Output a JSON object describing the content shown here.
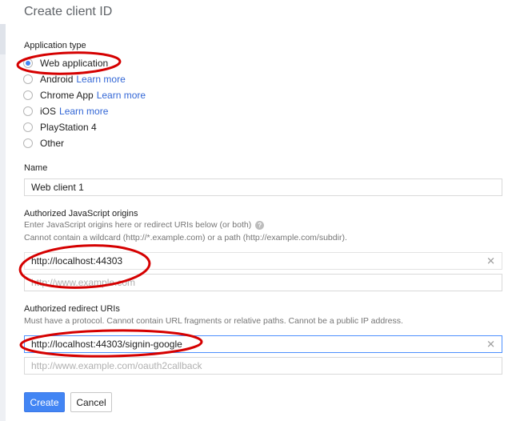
{
  "page": {
    "title": "Create client ID"
  },
  "application_type": {
    "label": "Application type",
    "options": [
      {
        "label": "Web application",
        "link": "",
        "checked": true
      },
      {
        "label": "Android",
        "link": "Learn more",
        "checked": false
      },
      {
        "label": "Chrome App",
        "link": "Learn more",
        "checked": false
      },
      {
        "label": "iOS",
        "link": "Learn more",
        "checked": false
      },
      {
        "label": "PlayStation 4",
        "link": "",
        "checked": false
      },
      {
        "label": "Other",
        "link": "",
        "checked": false
      }
    ]
  },
  "name": {
    "label": "Name",
    "value": "Web client 1"
  },
  "js_origins": {
    "label": "Authorized JavaScript origins",
    "hint1": "Enter JavaScript origins here or redirect URIs below (or both)",
    "hint2": "Cannot contain a wildcard (http://*.example.com) or a path (http://example.com/subdir).",
    "value": "http://localhost:44303",
    "placeholder": "http://www.example.com",
    "clear_icon": "close-icon",
    "help_icon": "help-icon"
  },
  "redirect_uris": {
    "label": "Authorized redirect URIs",
    "hint": "Must have a protocol. Cannot contain URL fragments or relative paths. Cannot be a public IP address.",
    "value": "http://localhost:44303/signin-google",
    "placeholder": "http://www.example.com/oauth2callback",
    "clear_icon": "close-icon"
  },
  "actions": {
    "create": "Create",
    "cancel": "Cancel"
  },
  "colors": {
    "primary": "#4285f4",
    "link": "#3367d6",
    "annotation": "#d50000"
  }
}
